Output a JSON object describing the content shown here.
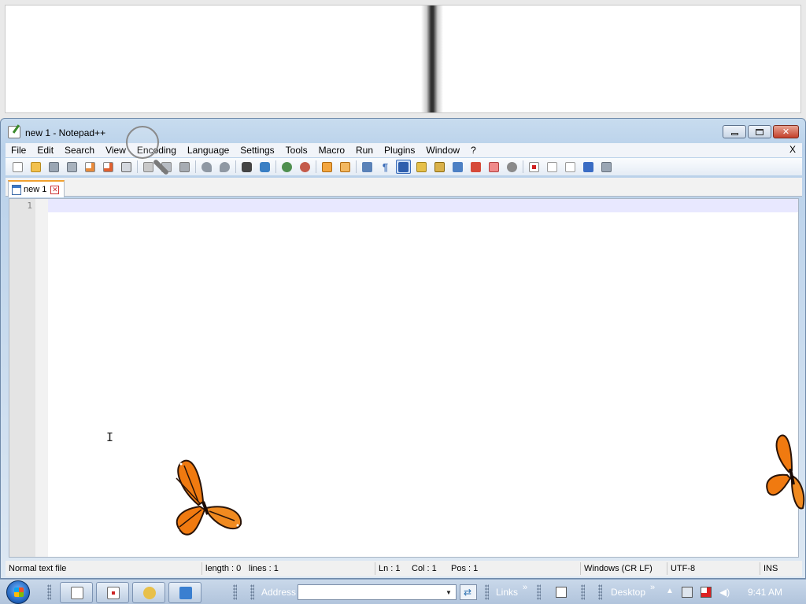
{
  "window": {
    "title": "new 1 - Notepad++"
  },
  "menu": {
    "items": [
      "File",
      "Edit",
      "Search",
      "View",
      "Encoding",
      "Language",
      "Settings",
      "Tools",
      "Macro",
      "Run",
      "Plugins",
      "Window",
      "?"
    ],
    "close_doc": "X"
  },
  "tabs": [
    {
      "label": "new 1"
    }
  ],
  "editor": {
    "line_numbers": [
      "1"
    ],
    "content": ""
  },
  "status": {
    "file_type": "Normal text file",
    "length": "length : 0",
    "lines": "lines : 1",
    "ln": "Ln : 1",
    "col": "Col : 1",
    "pos": "Pos : 1",
    "eol": "Windows (CR LF)",
    "encoding": "UTF-8",
    "mode": "INS"
  },
  "taskbar": {
    "address_label": "Address",
    "address_value": "",
    "links_label": "Links",
    "desktop_label": "Desktop",
    "chevron": "»",
    "clock": "9:41 AM"
  },
  "colors": {
    "current_line": "#e8e8ff",
    "gutter": "#e4e4e4",
    "tab_accent": "#f0a030",
    "butterfly": "#f07a10"
  }
}
